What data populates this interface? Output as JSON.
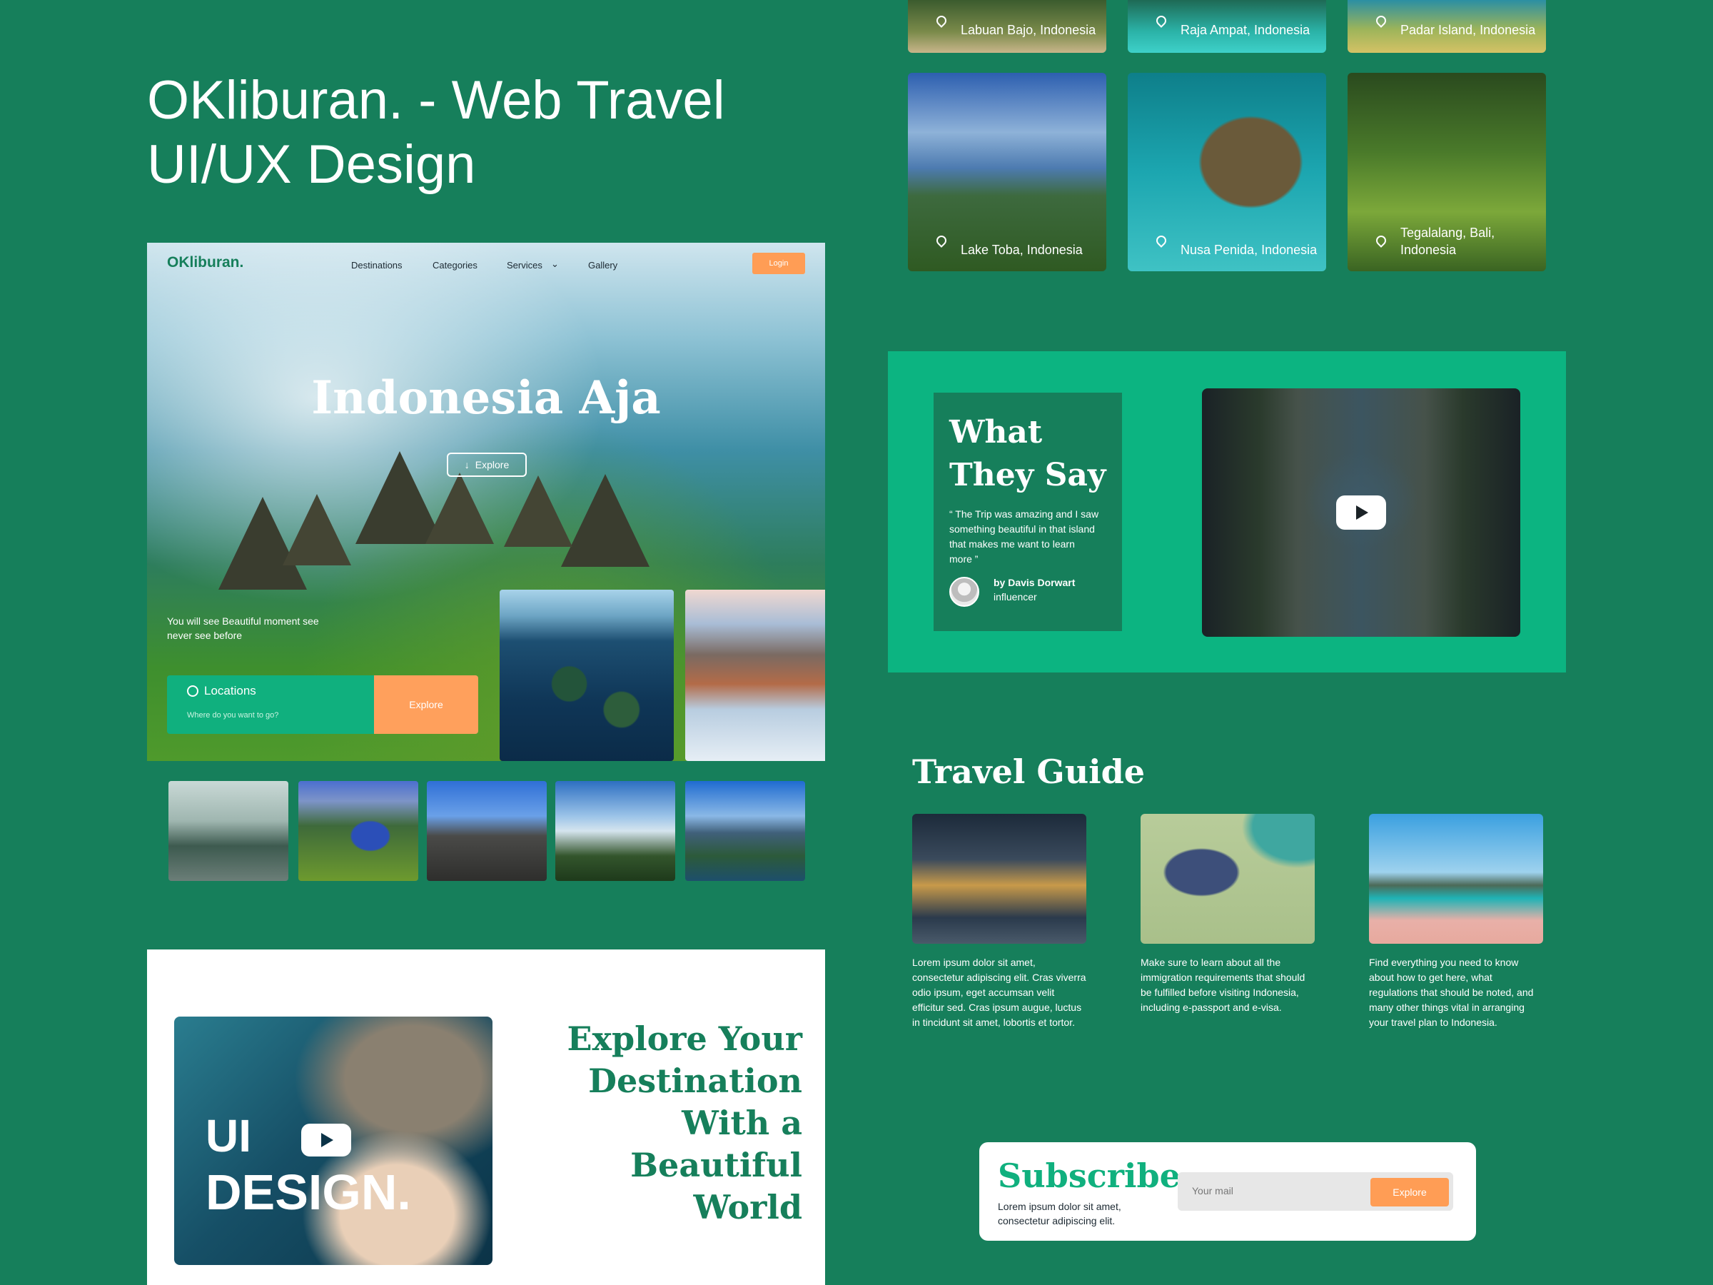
{
  "page_title": "OKliburan. - Web Travel UI/UX Design",
  "hero": {
    "logo": "OKliburan.",
    "nav": [
      "Destinations",
      "Categories",
      "Services",
      "Gallery"
    ],
    "login_label": "Login",
    "headline": "Indonesia Aja",
    "explore_label": "Explore",
    "tagline": "You will see Beautiful moment see never see before",
    "search": {
      "label": "Locations",
      "placeholder": "Where do you want to go?",
      "button_label": "Explore"
    }
  },
  "destinations": [
    {
      "label": "Labuan Bajo, Indonesia"
    },
    {
      "label": "Raja Ampat, Indonesia"
    },
    {
      "label": "Padar Island, Indonesia"
    },
    {
      "label": "Lake Toba, Indonesia"
    },
    {
      "label": "Nusa Penida, Indonesia"
    },
    {
      "label": "Tegalalang, Bali, Indonesia"
    }
  ],
  "testimonial": {
    "title": "What They Say",
    "quote": "“ The Trip was amazing and I saw something beautiful in that island that makes me want to learn more ”",
    "author": "by Davis Dorwart",
    "role": "influencer"
  },
  "promo": {
    "image_text_line1": "UI",
    "image_text_line2": "DESIGN.",
    "heading": "Explore Your Destination With a Beautiful World"
  },
  "travel_guide": {
    "title": "Travel Guide",
    "items": [
      {
        "text": "Lorem ipsum dolor sit amet, consectetur adipiscing elit. Cras viverra odio ipsum, eget accumsan velit efficitur sed. Cras ipsum augue, luctus in tincidunt sit amet, lobortis et tortor."
      },
      {
        "text": "Make sure to learn about all the immigration requirements that should be fulfilled before visiting Indonesia, including e-passport and e-visa."
      },
      {
        "text": "Find everything you need to know about how to get here, what regulations that should be noted, and many other things vital in arranging your travel plan to Indonesia."
      }
    ]
  },
  "subscribe": {
    "title": "Subscribe",
    "text": "Lorem ipsum dolor sit amet, consectetur adipiscing elit.",
    "placeholder": "Your mail",
    "button_label": "Explore"
  },
  "colors": {
    "background": "#167f5b",
    "accent_green": "#10b07e",
    "accent_orange": "#ff9d55"
  }
}
